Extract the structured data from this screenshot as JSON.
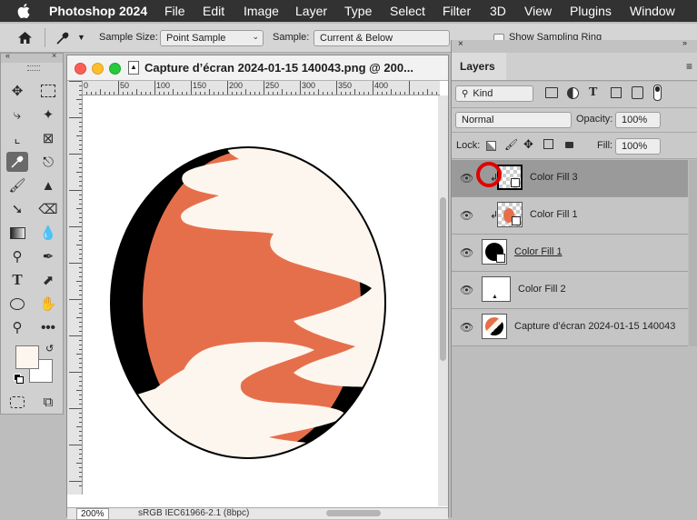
{
  "menubar": {
    "apple_icon": "apple-icon",
    "items": [
      "Photoshop 2024",
      "File",
      "Edit",
      "Image",
      "Layer",
      "Type",
      "Select",
      "Filter",
      "3D",
      "View",
      "Plugins",
      "Window"
    ]
  },
  "options": {
    "sample_size_label": "Sample Size:",
    "sample_size_value": "Point Sample",
    "sample_label": "Sample:",
    "sample_value": "Current & Below",
    "show_ring_label": "Show Sampling Ring"
  },
  "document": {
    "title": "Capture d’écran 2024-01-15 140043.png @ 200...",
    "zoom": "200%",
    "color_profile": "sRGB IEC61966-2.1 (8bpc)",
    "ruler_ticks": [
      "0",
      "50",
      "100",
      "150",
      "200",
      "250",
      "300",
      "350",
      "400"
    ],
    "canvas_colors": {
      "ring": "#000000",
      "orange": "#e66f4b",
      "cream": "#fdf6ee"
    }
  },
  "layers_panel": {
    "tab": "Layers",
    "filter_kind": "Kind",
    "blend_mode": "Normal",
    "opacity_label": "Opacity:",
    "opacity_value": "100%",
    "lock_label": "Lock:",
    "fill_label": "Fill:",
    "fill_value": "100%",
    "layers": [
      {
        "name": "Color Fill 3",
        "selected": true,
        "clipped": true
      },
      {
        "name": "Color Fill 1",
        "selected": false,
        "clipped": true
      },
      {
        "name": "Color Fill 1",
        "selected": false,
        "clipped": false
      },
      {
        "name": "Color Fill 2",
        "selected": false,
        "clipped": false
      },
      {
        "name": "Capture d’écran 2024-01-15 140043",
        "selected": false,
        "clipped": false
      }
    ]
  }
}
